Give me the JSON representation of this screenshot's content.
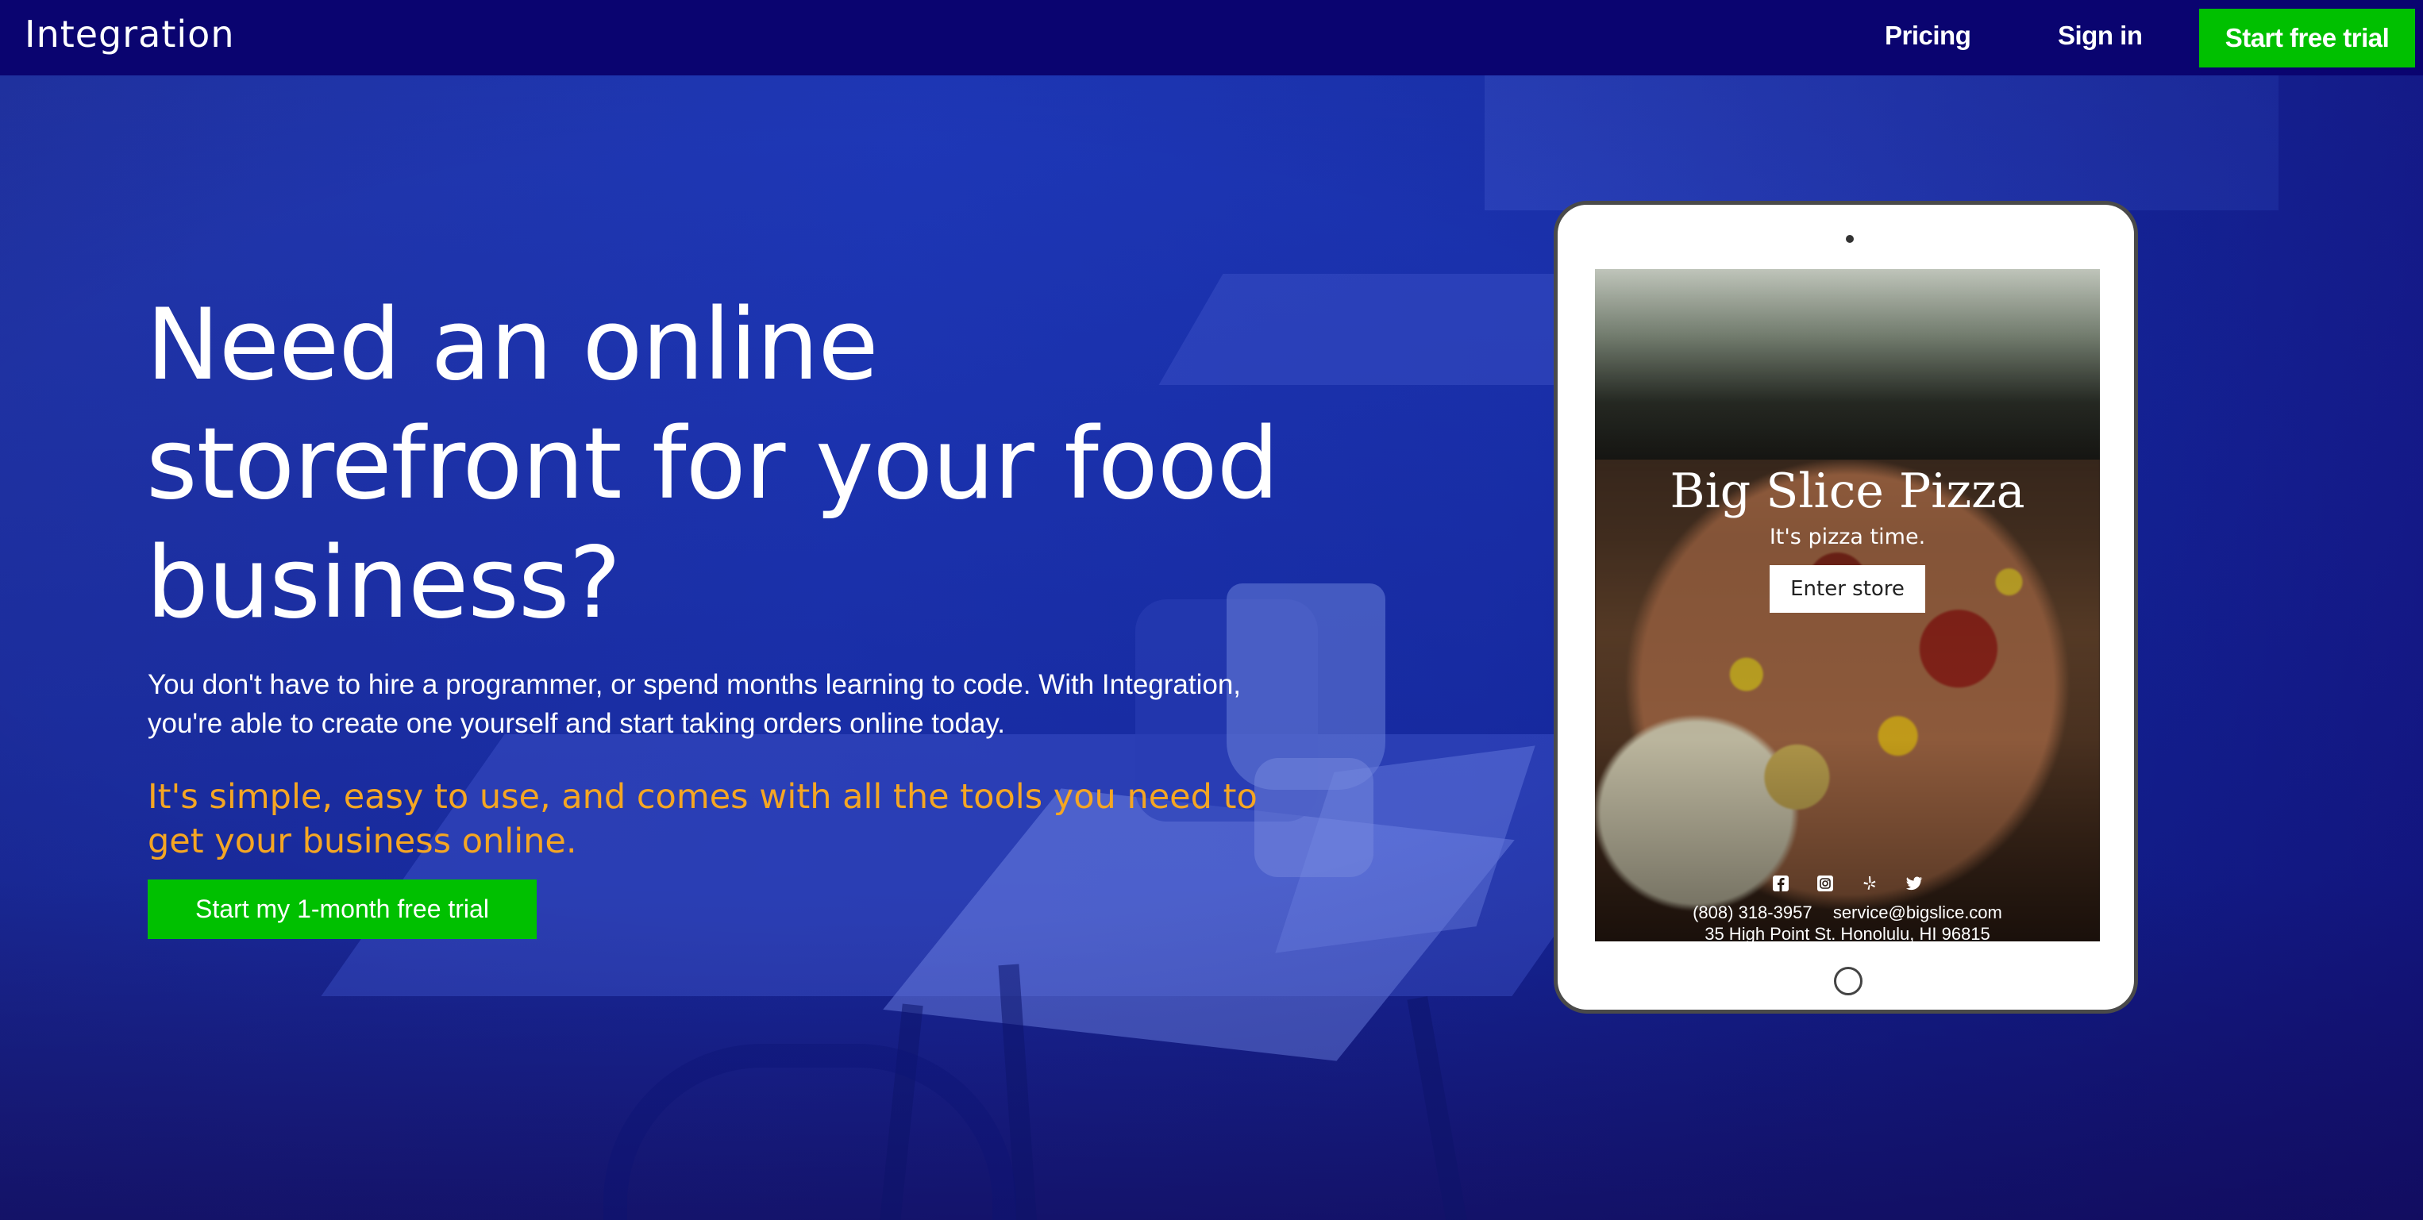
{
  "nav": {
    "brand": "Integration",
    "pricing": "Pricing",
    "sign_in": "Sign in",
    "cta": "Start free trial"
  },
  "hero": {
    "headline_line1": "Need an online",
    "headline_line2": "storefront for your food",
    "headline_line3": "business?",
    "subtext_line1": "You don't have to hire a programmer, or spend months learning to code. With Integration,",
    "subtext_line2": "you're able to create one yourself and start taking orders online today.",
    "tagline_line1": "It's simple, easy to use, and comes with all the tools you need to",
    "tagline_line2": "get your business online.",
    "cta": "Start my 1-month free trial"
  },
  "preview": {
    "store_name": "Big Slice Pizza",
    "store_tagline": "It's pizza time.",
    "enter_button": "Enter store",
    "social_icons": [
      "facebook-icon",
      "instagram-icon",
      "yelp-icon",
      "twitter-icon"
    ],
    "phone": "(808) 318-3957",
    "email": "service@bigslice.com",
    "address": "35 High Point St. Honolulu, HI 96815"
  },
  "colors": {
    "nav_bg": "#0a0470",
    "cta_green": "#00c000",
    "tagline_orange": "#f5a623",
    "hero_blue": "#1e38b8"
  }
}
